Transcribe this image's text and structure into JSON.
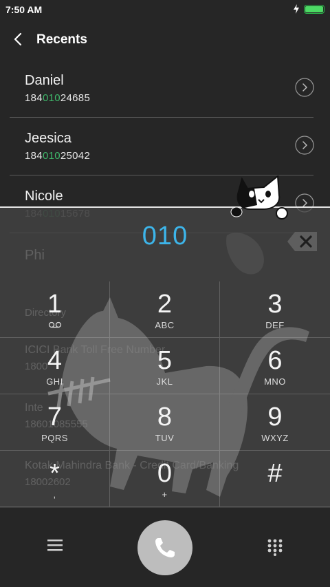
{
  "status_bar": {
    "time": "7:50 AM",
    "battery_color": "#4cd964"
  },
  "header": {
    "title": "Recents"
  },
  "recents": [
    {
      "name": "Daniel",
      "number_pre": "184",
      "number_match": "010",
      "number_post": "24685"
    },
    {
      "name": "Jeesica",
      "number_pre": "184",
      "number_match": "010",
      "number_post": "25042"
    },
    {
      "name": "Nicole",
      "number_pre": "184",
      "number_match": "010",
      "number_post": "15678"
    },
    {
      "name": "Phi",
      "number_pre": "",
      "number_match": "",
      "number_post": ""
    }
  ],
  "directory": {
    "label": "Directory",
    "items": [
      {
        "name": "ICICI Bank Toll Free Number",
        "number": "1800"
      },
      {
        "name": "Inte",
        "number": "18601085555"
      },
      {
        "name": "Kotak Mahindra Bank - Credit Card/Banking",
        "number": "18002602"
      }
    ]
  },
  "dialer": {
    "dialed": "010",
    "accent_color": "#3db5ea",
    "match_color": "#3fb86b",
    "keys": [
      {
        "digit": "1",
        "letters": ""
      },
      {
        "digit": "2",
        "letters": "ABC"
      },
      {
        "digit": "3",
        "letters": "DEF"
      },
      {
        "digit": "4",
        "letters": "GHI"
      },
      {
        "digit": "5",
        "letters": "JKL"
      },
      {
        "digit": "6",
        "letters": "MNO"
      },
      {
        "digit": "7",
        "letters": "PQRS"
      },
      {
        "digit": "8",
        "letters": "TUV"
      },
      {
        "digit": "9",
        "letters": "WXYZ"
      },
      {
        "digit": "*",
        "letters": ","
      },
      {
        "digit": "0",
        "letters": "+"
      },
      {
        "digit": "#",
        "letters": ""
      }
    ]
  }
}
